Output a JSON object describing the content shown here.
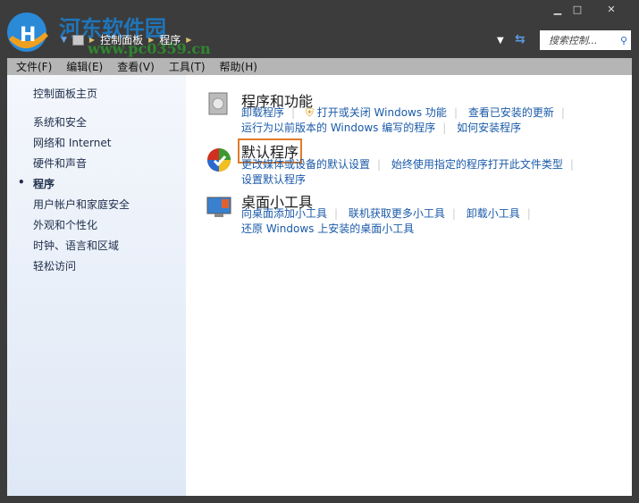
{
  "watermark": {
    "name": "河东软件园",
    "url": "www.pc0359.cn"
  },
  "window": {
    "minimize": "▁",
    "maximize": "□",
    "close": "✕"
  },
  "breadcrumb": [
    "控制面板",
    "程序"
  ],
  "search": {
    "placeholder": "搜索控制..."
  },
  "menu": [
    "文件(F)",
    "编辑(E)",
    "查看(V)",
    "工具(T)",
    "帮助(H)"
  ],
  "sidebar": {
    "home": "控制面板主页",
    "items": [
      "系统和安全",
      "网络和 Internet",
      "硬件和声音",
      "程序",
      "用户帐户和家庭安全",
      "外观和个性化",
      "时钟、语言和区域",
      "轻松访问"
    ],
    "current": "程序"
  },
  "sections": [
    {
      "title": "程序和功能",
      "links": [
        "卸载程序",
        "打开或关闭 Windows 功能",
        "查看已安装的更新",
        "运行为以前版本的 Windows 编写的程序",
        "如何安装程序"
      ]
    },
    {
      "title": "默认程序",
      "links": [
        "更改媒体或设备的默认设置",
        "始终使用指定的程序打开此文件类型",
        "设置默认程序"
      ]
    },
    {
      "title": "桌面小工具",
      "links": [
        "向桌面添加小工具",
        "联机获取更多小工具",
        "卸载小工具",
        "还原 Windows 上安装的桌面小工具"
      ]
    }
  ],
  "colors": {
    "highlight": "#e07c2c",
    "link": "#1a5aa8"
  }
}
